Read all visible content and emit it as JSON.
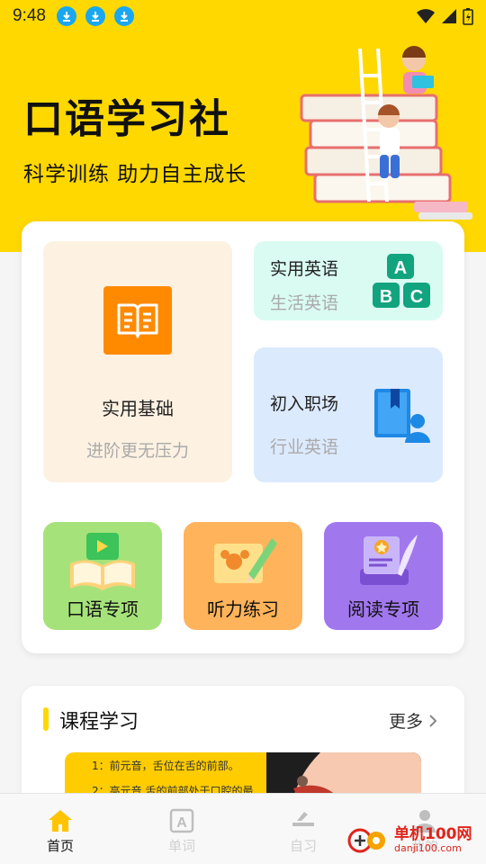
{
  "status_bar": {
    "time": "9:48"
  },
  "hero": {
    "title": "口语学习社",
    "subtitle": "科学训练  助力自主成长"
  },
  "features": {
    "basic": {
      "title": "实用基础",
      "subtitle": "进阶更无压力",
      "icon": "book-icon"
    },
    "english": {
      "title": "实用英语",
      "subtitle": "生活英语",
      "icon": "abc-blocks-icon"
    },
    "workplace": {
      "title": "初入职场",
      "subtitle": "行业英语",
      "icon": "book-person-icon"
    }
  },
  "categories": [
    {
      "label": "口语专项",
      "color": "#a6e27a",
      "icon": "play-book-icon"
    },
    {
      "label": "听力练习",
      "color": "#ffb35a",
      "icon": "map-pencil-icon"
    },
    {
      "label": "阅读专项",
      "color": "#a177ee",
      "icon": "quill-book-icon"
    }
  ],
  "courses": {
    "title": "课程学习",
    "more": "更多",
    "preview_lines": [
      "1：前元音，舌位在舌的前部。",
      "2：高元音,舌的前部处于口腔的最"
    ]
  },
  "tabs": [
    {
      "label": "首页",
      "active": true
    },
    {
      "label": "单词",
      "active": false
    },
    {
      "label": "自习",
      "active": false
    },
    {
      "label": "我的",
      "active": false
    }
  ],
  "watermark": {
    "brand": "单机100网",
    "domain": "danji100.com"
  },
  "colors": {
    "brand_yellow": "#ffd800",
    "accent_orange": "#ff8a00",
    "download_blue": "#19a7f0"
  }
}
